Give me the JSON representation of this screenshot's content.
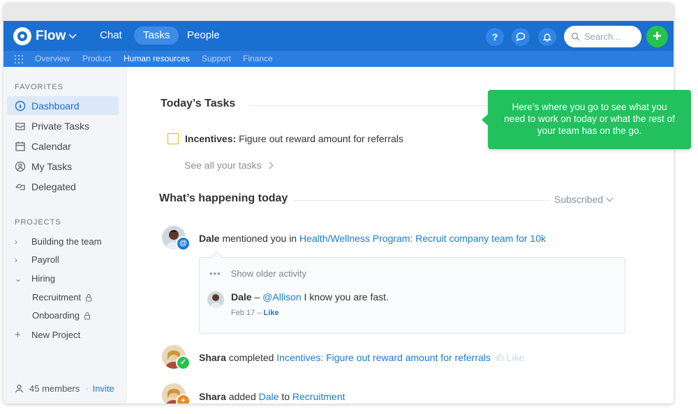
{
  "app": {
    "name": "Flow"
  },
  "nav": {
    "tabs": [
      {
        "label": "Chat",
        "active": false
      },
      {
        "label": "Tasks",
        "active": true
      },
      {
        "label": "People",
        "active": false
      }
    ],
    "help_label": "?",
    "search_placeholder": "Search...",
    "add_label": "+"
  },
  "subnav": {
    "items": [
      "Overview",
      "Product",
      "Human resources",
      "Support",
      "Finance"
    ],
    "active": "Human resources"
  },
  "sidebar": {
    "favorites_heading": "FAVORITES",
    "favorites": [
      {
        "label": "Dashboard",
        "icon": "dashboard-icon",
        "active": true
      },
      {
        "label": "Private Tasks",
        "icon": "inbox-icon",
        "active": false
      },
      {
        "label": "Calendar",
        "icon": "calendar-icon",
        "active": false
      },
      {
        "label": "My Tasks",
        "icon": "person-icon",
        "active": false
      },
      {
        "label": "Delegated",
        "icon": "delegate-icon",
        "active": false
      }
    ],
    "projects_heading": "PROJECTS",
    "projects": [
      {
        "label": "Building the team",
        "chevron": "right"
      },
      {
        "label": "Payroll",
        "chevron": "right"
      },
      {
        "label": "Hiring",
        "chevron": "down"
      }
    ],
    "subprojects": [
      {
        "label": "Recruitment",
        "locked": true
      },
      {
        "label": "Onboarding",
        "locked": true
      }
    ],
    "new_project_label": "New Project",
    "members_label": "45 members",
    "separator": "·",
    "invite_label": "Invite"
  },
  "main": {
    "today_title": "Today’s Tasks",
    "task": {
      "project": "Incentives:",
      "title": "Figure out reward amount for referrals"
    },
    "see_all_label": "See all your tasks",
    "happening_title": "What’s happening today",
    "subscribed_label": "Subscribed",
    "activities": [
      {
        "actor": "Dale",
        "verb": "mentioned you in",
        "target": "Health/Wellness Program: Recruit company team for 10k",
        "badge": "@"
      },
      {
        "actor": "Shara",
        "verb": "completed",
        "target": "Incentives: Figure out reward amount for referrals",
        "like": "Like",
        "badge": "✓"
      },
      {
        "actor": "Shara",
        "verb": "added",
        "target": "Dale",
        "verb2": "to",
        "target2": "Recruitment",
        "badge": "+"
      }
    ],
    "thread": {
      "older_label": "Show older activity",
      "comment_author": "Dale",
      "comment_dash": "–",
      "comment_mention": "@Allison",
      "comment_text": "I know you are fast.",
      "comment_date": "Feb 17 –",
      "comment_like": "Like"
    }
  },
  "tooltip": {
    "text": "Here’s where you go to see what you need to work on today or what the rest of your team has on the go."
  },
  "colors": {
    "nav_blue": "#1a6fd0",
    "subnav_blue": "#2c7de0",
    "green": "#22c15d",
    "link": "#1a7ad8"
  }
}
